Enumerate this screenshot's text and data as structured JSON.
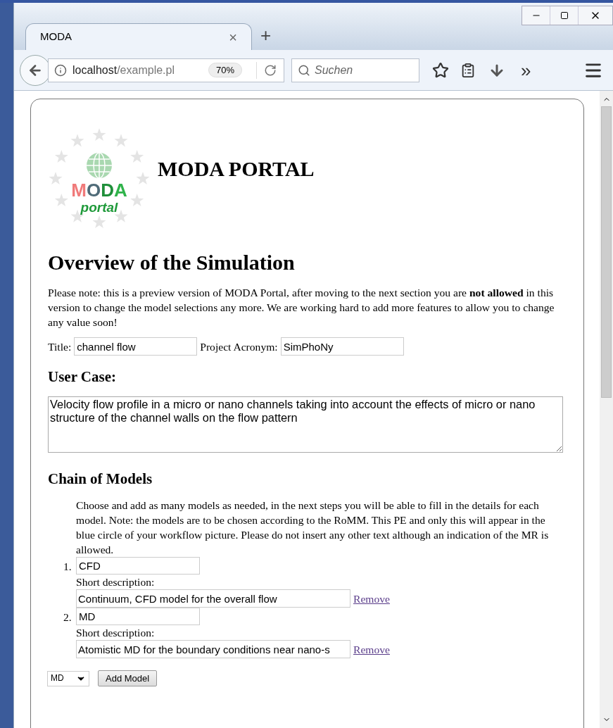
{
  "browser": {
    "tab_title": "MODA",
    "tab_close": "×",
    "new_tab": "+",
    "url_host": "localhost",
    "url_path": "/example.pl",
    "zoom": "70%",
    "search_placeholder": "Suchen",
    "overflow": "»"
  },
  "logo": {
    "letters": [
      {
        "text": "M",
        "color": "#f07a7a"
      },
      {
        "text": "O",
        "color": "#4f6b78"
      },
      {
        "text": "D",
        "color": "#1f8f3a"
      },
      {
        "text": "A",
        "color": "#2fb34a"
      }
    ],
    "subtitle": "portal"
  },
  "site_title": "MODA PORTAL",
  "heading": "Overview of the Simulation",
  "note": "Please note: this is a preview version of MODA Portal, after moving to the next section you are **not allowed** in this version to change the model selections any more. We are working hard to add more features to allow you to change any value soon!",
  "fields": [
    {
      "label": "Title:",
      "value": "channel flow"
    },
    {
      "label": "Project Acronym:",
      "value": "SimPhoNy"
    }
  ],
  "user_case": {
    "heading": "User Case:",
    "value": "Velocity flow profile in a micro or nano channels taking into account the effects of micro or nano structure of the channel walls on the flow pattern"
  },
  "chain": {
    "heading": "Chain of Models",
    "intro": "Choose and add as many models as needed, in the next steps you will be able to fill in the details for each model. Note: the models are to be chosen according to the RoMM. This PE and only this will appear in the blue circle of your workflow picture. Please do not insert any other text although an indication of the MR is allowed.",
    "models": [
      {
        "number": "1.",
        "name": "CFD",
        "description_label": "Short description:",
        "description": "Continuum, CFD model for the overall flow",
        "remove": "Remove"
      },
      {
        "number": "2.",
        "name": "MD",
        "description_label": "Short description:",
        "description": "Atomistic MD for the boundary conditions near nano-s",
        "remove": "Remove"
      }
    ],
    "select_value": "MD",
    "add_button": "Add Model"
  }
}
